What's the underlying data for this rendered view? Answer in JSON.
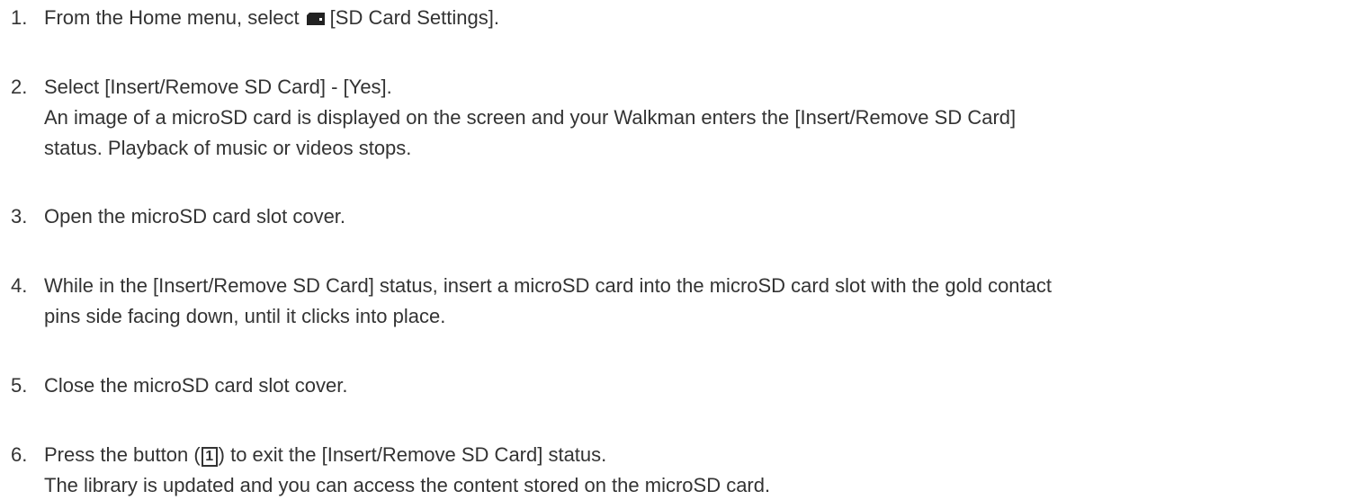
{
  "steps": [
    {
      "number": "1.",
      "lines": [
        "From the Home menu, select",
        "[SD Card Settings]."
      ],
      "icon": "sd-card-icon"
    },
    {
      "number": "2.",
      "lines": [
        "Select [Insert/Remove SD Card] - [Yes].",
        "An image of a microSD card is displayed on the screen and your Walkman enters the [Insert/Remove SD Card]",
        "status. Playback of music or videos stops."
      ]
    },
    {
      "number": "3.",
      "lines": [
        "Open the microSD card slot cover."
      ]
    },
    {
      "number": "4.",
      "lines": [
        "While in the [Insert/Remove SD Card] status, insert a microSD card into the microSD card slot with the gold contact",
        "pins side facing down, until it clicks into place."
      ]
    },
    {
      "number": "5.",
      "lines": [
        "Close the microSD card slot cover."
      ]
    },
    {
      "number": "6.",
      "lines": [
        "Press the button (",
        "1",
        ") to exit the [Insert/Remove SD Card] status.",
        "The library is updated and you can access the content stored on the microSD card."
      ]
    }
  ]
}
